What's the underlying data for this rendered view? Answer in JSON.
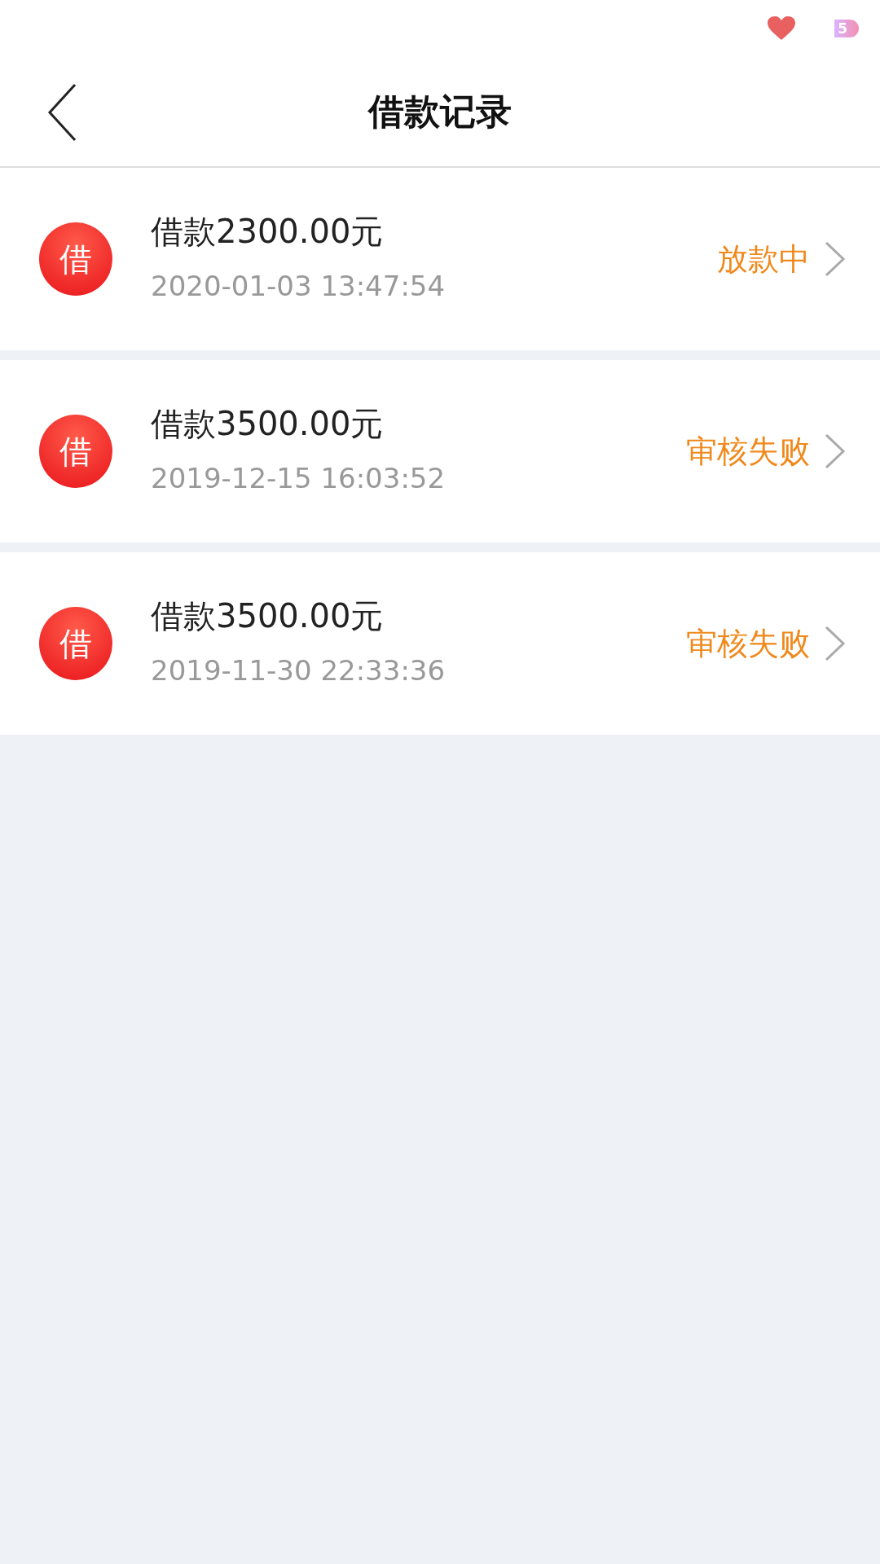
{
  "status_bar": {
    "battery": "5"
  },
  "header": {
    "title": "借款记录"
  },
  "records": [
    {
      "icon_text": "借",
      "title": "借款2300.00元",
      "time": "2020-01-03 13:47:54",
      "status": "放款中"
    },
    {
      "icon_text": "借",
      "title": "借款3500.00元",
      "time": "2019-12-15 16:03:52",
      "status": "审核失败"
    },
    {
      "icon_text": "借",
      "title": "借款3500.00元",
      "time": "2019-11-30 22:33:36",
      "status": "审核失败"
    }
  ]
}
